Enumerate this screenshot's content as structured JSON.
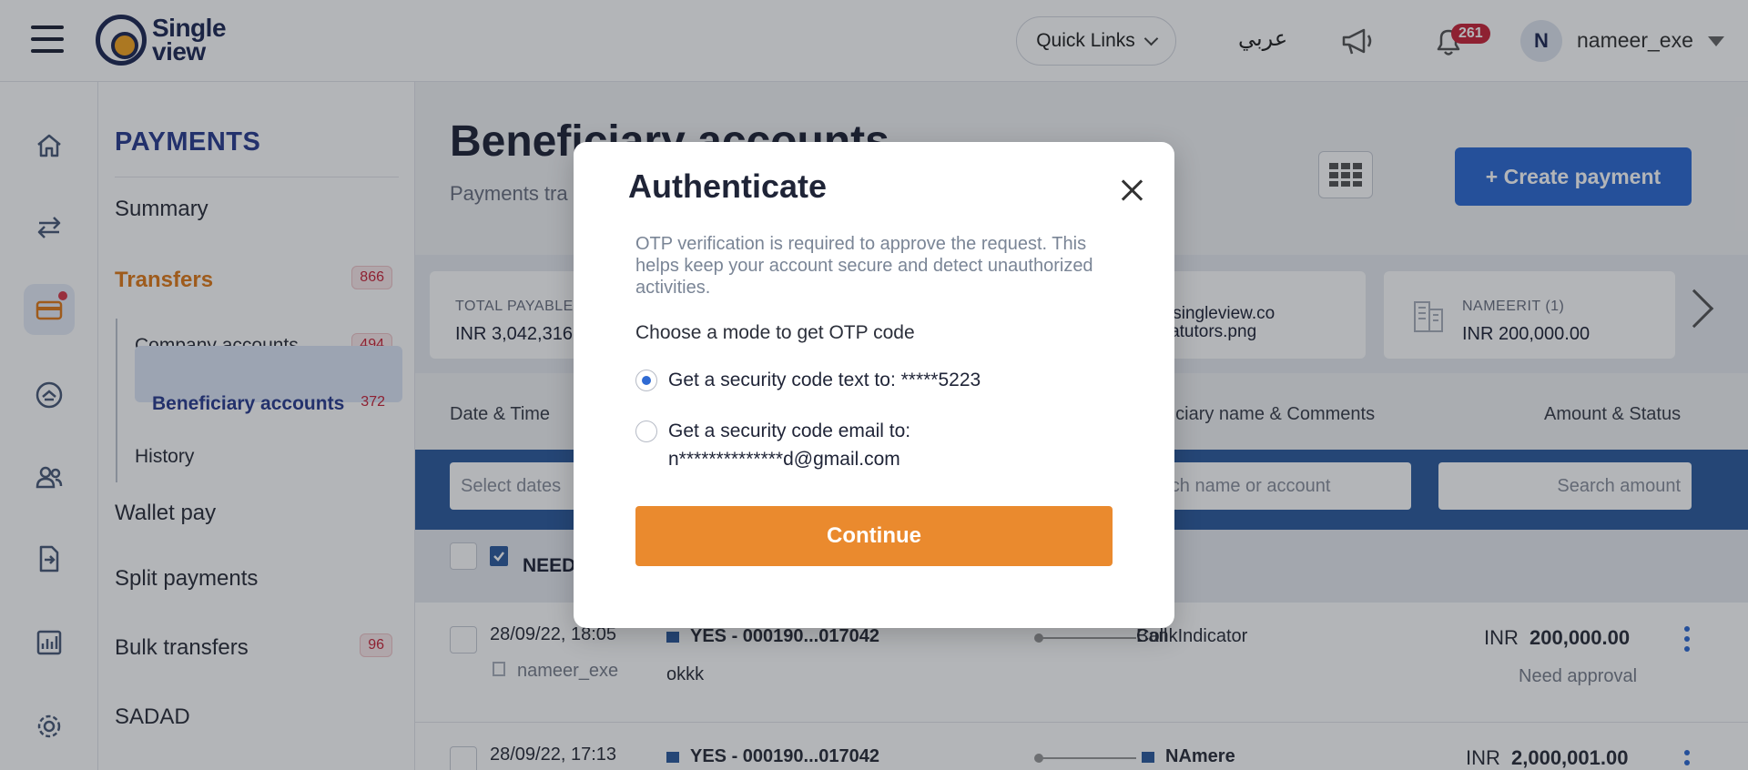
{
  "header": {
    "logo_text_line1": "Single",
    "logo_text_line2": "view",
    "quick_links": "Quick Links",
    "language": "عربي",
    "notification_count": "261",
    "avatar_initial": "N",
    "username": "nameer_exe"
  },
  "sidebar": {
    "section_title": "PAYMENTS",
    "items": [
      {
        "label": "Summary"
      },
      {
        "label": "Transfers",
        "badge": "866"
      },
      {
        "label": "Wallet pay"
      },
      {
        "label": "Split payments"
      },
      {
        "label": "Bulk transfers",
        "badge": "96"
      },
      {
        "label": "SADAD"
      }
    ],
    "children": [
      {
        "label": "Company accounts",
        "badge": "494"
      },
      {
        "label": "Beneficiary accounts",
        "badge": "372"
      },
      {
        "label": "History"
      }
    ]
  },
  "main": {
    "title": "Beneficiary accounts",
    "subtitle": "Payments tra",
    "create_button": "+ Create payment",
    "cards": [
      {
        "label": "TOTAL PAYABLE",
        "value": "INR 3,042,316"
      },
      {
        "broken_image_line1": "images.onesingleview.co",
        "broken_image_line2": "27681-biralatutors.png"
      },
      {
        "label": "NAMEERIT (1)",
        "value": "INR 200,000.00"
      }
    ],
    "columns": {
      "date_time": "Date & Time",
      "beneficiary": "eficiary name & Comments",
      "amount_status": "Amount & Status"
    },
    "filters": {
      "dates": "Select dates",
      "name": "arch name or account",
      "amount": "Search amount"
    },
    "needs_label": "NEED",
    "rows": [
      {
        "datetime": "28/09/22, 18:05",
        "user": "nameer_exe",
        "account": "YES - 000190...017042",
        "comment": "okkk",
        "beneficiary": "BankIndicator",
        "beneficiary_overlap": "Coll",
        "currency": "INR",
        "amount": "200,000.00",
        "status": "Need approval"
      },
      {
        "datetime": "28/09/22, 17:13",
        "account": "YES - 000190...017042",
        "beneficiary": "NAmere",
        "currency": "INR",
        "amount": "2,000,001.00"
      }
    ]
  },
  "modal": {
    "title": "Authenticate",
    "description": "OTP verification is required to approve the request. This helps keep your account secure and detect unauthorized activities.",
    "choose_label": "Choose a mode to get OTP code",
    "option_sms": "Get a security code text to: *****5223",
    "option_email_line1": "Get a security code email to:",
    "option_email_line2": "n**************d@gmail.com",
    "selected": "sms",
    "continue_label": "Continue"
  },
  "colors": {
    "primary_blue": "#2f6ad3",
    "orange": "#ea8a2e",
    "badge_red": "#c9263a",
    "navy": "#2b3d8f"
  }
}
